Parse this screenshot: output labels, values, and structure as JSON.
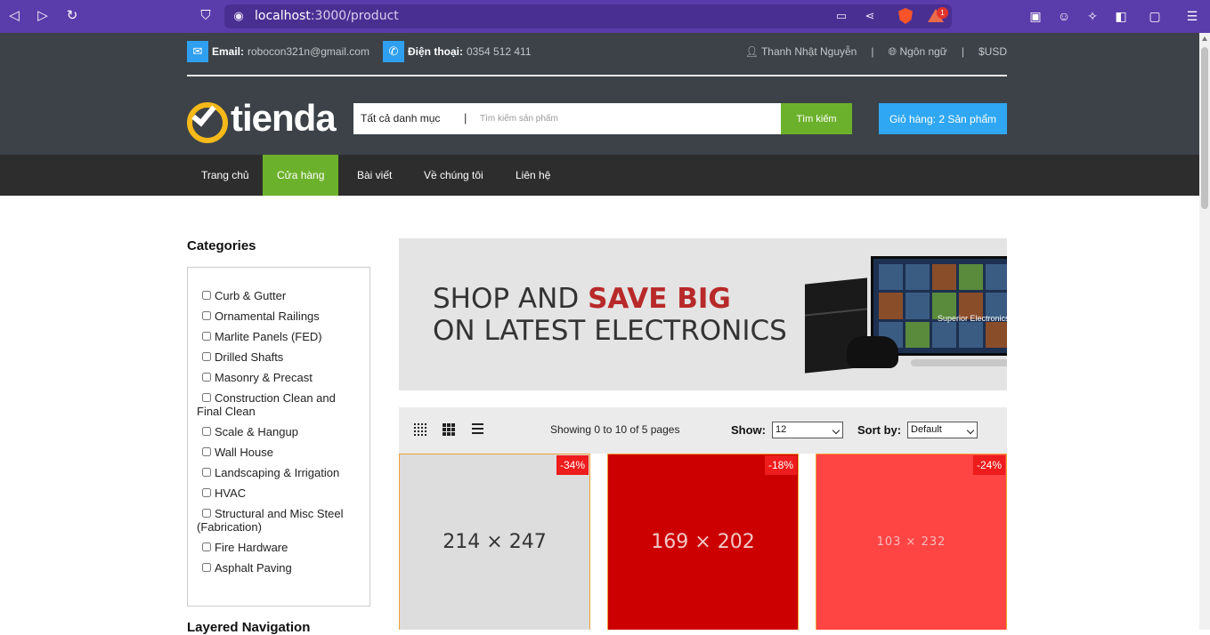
{
  "browser": {
    "url_host": "localhost",
    "url_path": ":3000/product",
    "rewards_count": "1"
  },
  "header": {
    "email_label": "Email:",
    "email_value": "robocon321n@gmail.com",
    "phone_label": "Điện thoại:",
    "phone_value": "0354 512 411",
    "user_name": "Thanh Nhật Nguyễn",
    "language": "Ngôn ngữ",
    "currency": "USD",
    "logo_text": "tienda",
    "search_category": "Tất cả danh mục",
    "search_separator": "|",
    "search_placeholder": "Tìm kiếm sản phẩm",
    "search_button": "Tìm kiếm",
    "cart_label": "Giỏ hàng: 2 Sản phẩm"
  },
  "nav": {
    "items": [
      "Trang chủ",
      "Cửa hàng",
      "Bài viết",
      "Về chúng tôi",
      "Liên hệ"
    ],
    "active_index": 1
  },
  "sidebar": {
    "title": "Categories",
    "categories": [
      "Curb & Gutter",
      "Ornamental Railings",
      "Marlite Panels (FED)",
      "Drilled Shafts",
      "Masonry & Precast",
      "Construction Clean and Final Clean",
      "Scale & Hangup",
      "Wall House",
      "Landscaping & Irrigation",
      "HVAC",
      "Structural and Misc Steel (Fabrication)",
      "Fire Hardware",
      "Asphalt Paving"
    ],
    "layered_title": "Layered Navigation"
  },
  "banner": {
    "line1_prefix": "SHOP AND ",
    "line1_highlight": "SAVE BIG",
    "line2": "ON LATEST ELECTRONICS",
    "tv_label": "Superior Electronics"
  },
  "toolbar": {
    "showing_text": "Showing 0 to 10 of 5 pages",
    "show_label": "Show:",
    "show_value": "12",
    "sort_label": "Sort by:",
    "sort_value": "Default"
  },
  "products": [
    {
      "placeholder": "214 × 247",
      "discount": "-34%",
      "bg": "#dddddd",
      "fg": "#333333"
    },
    {
      "placeholder": "169 × 202",
      "discount": "-18%",
      "bg": "#cc0000",
      "fg": "#f3c8c8"
    },
    {
      "placeholder": "103 × 232",
      "discount": "-24%",
      "bg": "#ff4444",
      "fg": "#f5bcbc"
    }
  ],
  "colors": {
    "brand_green": "#6cb12b",
    "brand_blue": "#2fa7f2",
    "header_bg": "#3c4248",
    "nav_bg": "#2d2d2d",
    "browser_purple": "#5b3cab"
  }
}
